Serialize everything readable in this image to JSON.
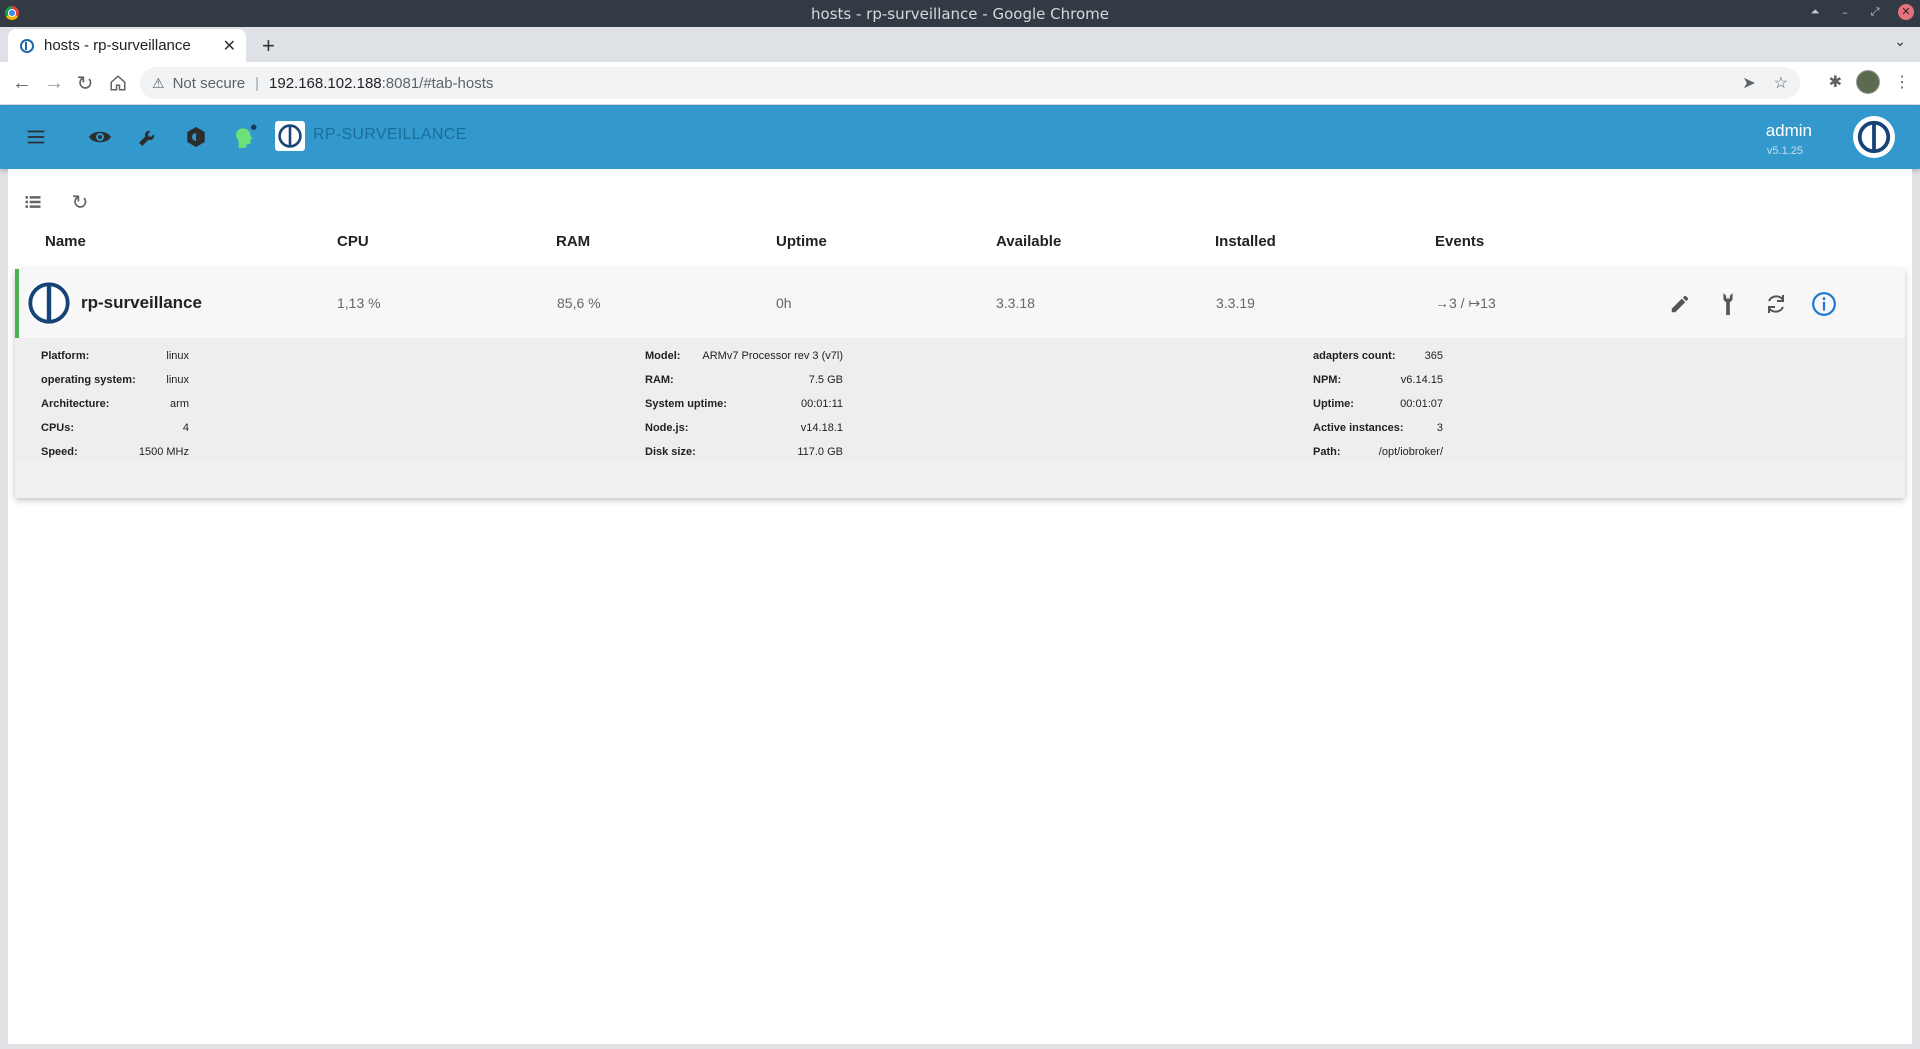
{
  "window": {
    "title": "hosts - rp-surveillance - Google Chrome"
  },
  "browser": {
    "tab_title": "hosts - rp-surveillance",
    "security_label": "Not secure",
    "url_host": "192.168.102.188",
    "url_rest": ":8081/#tab-hosts"
  },
  "app": {
    "title": "RP-SURVEILLANCE",
    "user": "admin",
    "version": "v5.1.25",
    "accent_color": "#3399cc",
    "toolbar_icons": [
      "menu-icon",
      "eye-icon",
      "wrench-icon",
      "settings-icon",
      "status-head-icon"
    ]
  },
  "table": {
    "columns": [
      "Name",
      "CPU",
      "RAM",
      "Uptime",
      "Available",
      "Installed",
      "Events"
    ]
  },
  "host": {
    "name": "rp-surveillance",
    "cpu": "1,13 %",
    "ram": "85,6 %",
    "uptime": "0h",
    "available": "3.3.18",
    "installed": "3.3.19",
    "events": "→3 / ↦13",
    "status_color": "#4caf50",
    "actions": [
      "edit-icon",
      "wrench-icon",
      "refresh-icon",
      "info-icon"
    ]
  },
  "details": {
    "col1": [
      {
        "k": "Platform:",
        "v": "linux"
      },
      {
        "k": "operating system:",
        "v": "linux"
      },
      {
        "k": "Architecture:",
        "v": "arm"
      },
      {
        "k": "CPUs:",
        "v": "4"
      },
      {
        "k": "Speed:",
        "v": "1500 MHz"
      }
    ],
    "col2": [
      {
        "k": "Model:",
        "v": "ARMv7 Processor rev 3 (v7l)"
      },
      {
        "k": "RAM:",
        "v": "7.5 GB"
      },
      {
        "k": "System uptime:",
        "v": "00:01:11"
      },
      {
        "k": "Node.js:",
        "v": "v14.18.1"
      },
      {
        "k": "Disk size:",
        "v": "117.0 GB"
      }
    ],
    "col3": [
      {
        "k": "adapters count:",
        "v": "365"
      },
      {
        "k": "NPM:",
        "v": "v6.14.15"
      },
      {
        "k": "Uptime:",
        "v": "00:01:07"
      },
      {
        "k": "Active instances:",
        "v": "3"
      },
      {
        "k": "Path:",
        "v": "/opt/iobroker/"
      }
    ]
  }
}
